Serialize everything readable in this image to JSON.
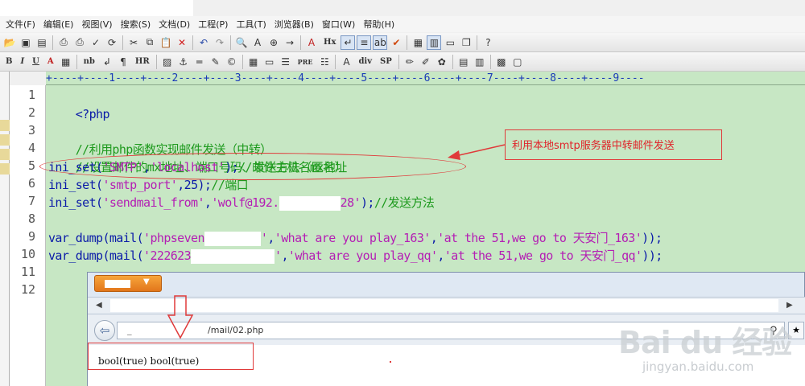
{
  "menu": {
    "items": [
      "文件(F)",
      "编辑(E)",
      "视图(V)",
      "搜索(S)",
      "文档(D)",
      "工程(P)",
      "工具(T)",
      "浏览器(B)",
      "窗口(W)",
      "帮助(H)"
    ]
  },
  "toolbar": {
    "hx_label": "Hx",
    "nb_label": "nb",
    "hr_label": "HR",
    "pre_label": "PRE",
    "div_label": "div",
    "sp_label": "SP",
    "bold_label": "B",
    "italic_label": "I",
    "underline_label": "U",
    "font_color_label": "A"
  },
  "ruler": "+----+----1----+----2----+----3----+----4----+----5----+----6----+----7----+----8----+----9----",
  "editor": {
    "line_numbers": [
      "1",
      "2",
      "3",
      "4",
      "5",
      "6",
      "7",
      "8",
      "9",
      "10",
      "11",
      "12"
    ],
    "l1": "<?php",
    "l3": "//利用php函数实现邮件发送（中转）",
    "l4": "//设置邮件的mx地址、端口号码、发送方法（匿名）",
    "l5": {
      "fn": "ini_set(",
      "s1": "'SMTP'",
      "comma": ",",
      "s2": "'localhost'",
      "end": ");",
      "comment": "//邮件主机名mx地址"
    },
    "l6": {
      "fn": "ini_set(",
      "s1": "'smtp_port'",
      "mid": ",25);",
      "comment": "//端口"
    },
    "l7": {
      "fn": "ini_set(",
      "s1": "'sendmail_from'",
      "comma": ",",
      "s2a": "'wolf@192.",
      "s2b": "28'",
      "end": ");",
      "comment": "//发送方法"
    },
    "l9": {
      "fn": "var_dump(mail(",
      "s1a": "'phpseven",
      "s1b": "'",
      "comma": ",",
      "s2": "'what are you play_163'",
      "comma2": ",",
      "s3": "'at the 51,we go to 天安门_163'",
      "end": "));"
    },
    "l10": {
      "fn": "var_dump(mail(",
      "s1a": "'222623",
      "s1b": "'",
      "comma": ",",
      "s2": "'what are you play_qq'",
      "comma2": ",",
      "s3": "'at the 51,we go to 天安门_qq'",
      "end": "));"
    }
  },
  "annotation": {
    "text": "利用本地smtp服务器中转邮件发送",
    "color": "#e03a3a"
  },
  "browser": {
    "url": "/mail/02.php",
    "url_prefix": "_",
    "output": "bool(true) bool(true)",
    "brand_color": "#e2761b"
  },
  "watermark": {
    "main": "Bai du 经验",
    "sub": "jingyan.baidu.com"
  },
  "colors": {
    "editor_bg": "#c7e7c4",
    "keyword": "#0a1aa8",
    "string": "#b41eb4",
    "comment": "#1e9a1e"
  }
}
